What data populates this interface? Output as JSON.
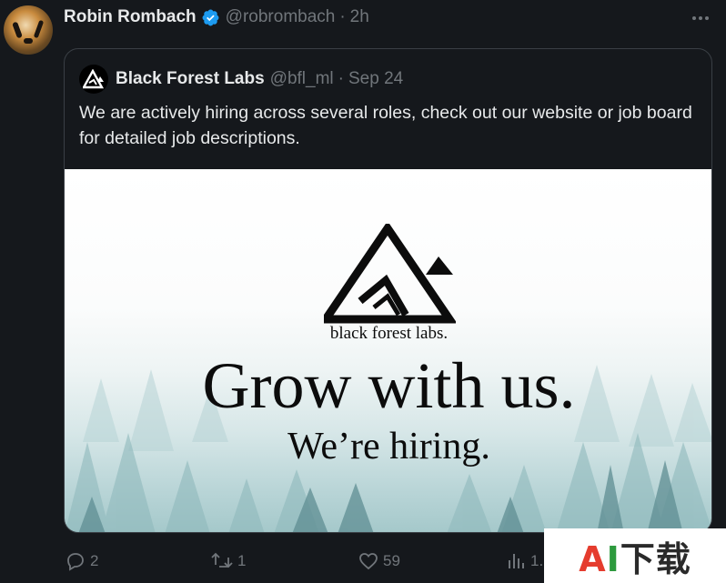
{
  "tweet": {
    "author_name": "Robin Rombach",
    "author_handle": "@robrombach",
    "separator": "·",
    "time": "2h",
    "more_label": "•••"
  },
  "quoted": {
    "author_name": "Black Forest Labs",
    "author_handle": "@bfl_ml",
    "separator": "·",
    "date": "Sep 24",
    "text": "We are actively hiring across several roles, check out our website or job board for detailed job descriptions.",
    "media": {
      "brand": "black forest labs.",
      "headline": "Grow with us.",
      "subline": "We’re hiring."
    }
  },
  "actions": {
    "replies": "2",
    "reposts": "1",
    "likes": "59",
    "views": "1."
  },
  "watermark": {
    "text_a": "A",
    "text_i": "I",
    "text_rest": "下载"
  },
  "colors": {
    "background": "#15181c",
    "text_primary": "#e7e9ea",
    "text_secondary": "#71767b",
    "verified_blue": "#1d9bf0",
    "border": "#3a3f45"
  }
}
